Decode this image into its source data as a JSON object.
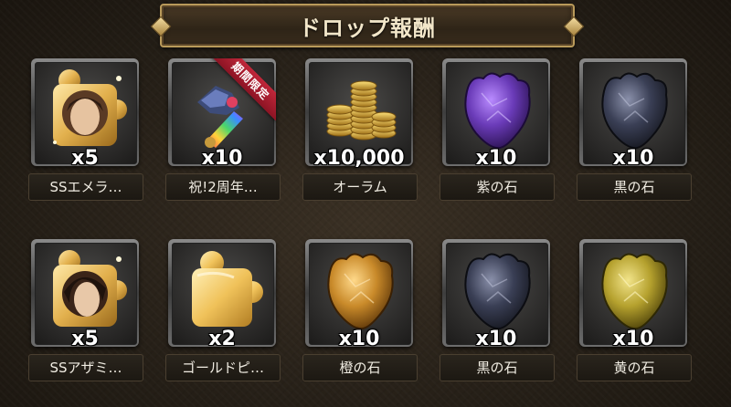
{
  "title": "ドロップ報酬",
  "rewards": [
    {
      "name": "SSエメラ…",
      "qty": "x5",
      "icon": "gold-puzzle-piece-portrait-icon"
    },
    {
      "name": "祝!2周年…",
      "qty": "x10",
      "icon": "crystal-weapon-icon",
      "badge": "期間限定"
    },
    {
      "name": "オーラム",
      "qty": "x10,000",
      "icon": "gold-coins-icon"
    },
    {
      "name": "紫の石",
      "qty": "x10",
      "icon": "purple-stone-icon"
    },
    {
      "name": "黒の石",
      "qty": "x10",
      "icon": "black-stone-icon"
    },
    {
      "name": "SSアザミ…",
      "qty": "x5",
      "icon": "gold-puzzle-piece-portrait-icon"
    },
    {
      "name": "ゴールドピ…",
      "qty": "x2",
      "icon": "gold-puzzle-piece-icon"
    },
    {
      "name": "橙の石",
      "qty": "x10",
      "icon": "orange-stone-icon"
    },
    {
      "name": "黒の石",
      "qty": "x10",
      "icon": "black-stone-icon"
    },
    {
      "name": "黄の石",
      "qty": "x10",
      "icon": "yellow-stone-icon"
    }
  ],
  "colors": {
    "purple_stone": "#6a3bb8",
    "black_stone": "#3a3f55",
    "orange_stone": "#c98a2a",
    "yellow_stone": "#b5a12e",
    "badge": "#c0273a"
  }
}
